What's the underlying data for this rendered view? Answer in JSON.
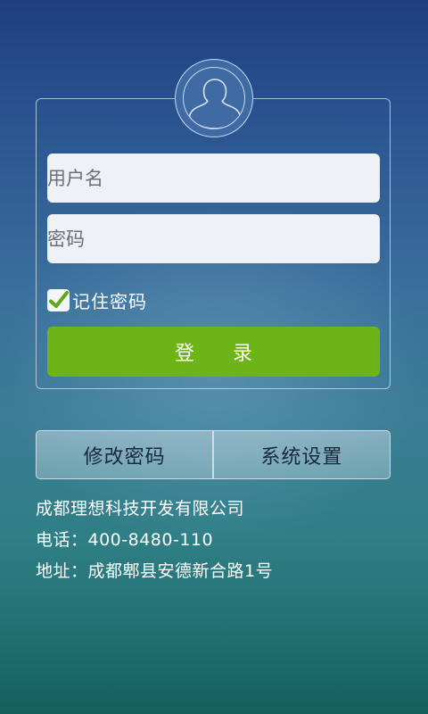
{
  "login": {
    "username_placeholder": "用户名",
    "password_placeholder": "密码",
    "remember_label": "记住密码",
    "remember_checked": true,
    "login_label": "登 录"
  },
  "actions": {
    "change_password_label": "修改密码",
    "system_settings_label": "系统设置"
  },
  "footer": {
    "company": "成都理想科技开发有限公司",
    "phone": "电话：400-8480-110",
    "address": "地址：成都郫县安德新合路1号"
  },
  "colors": {
    "login_button": "#6db31a",
    "field_background": "#eef1f6",
    "checkmark": "#5ea81a"
  },
  "icons": {
    "avatar": "user-silhouette-icon",
    "remember": "checkmark-icon"
  }
}
